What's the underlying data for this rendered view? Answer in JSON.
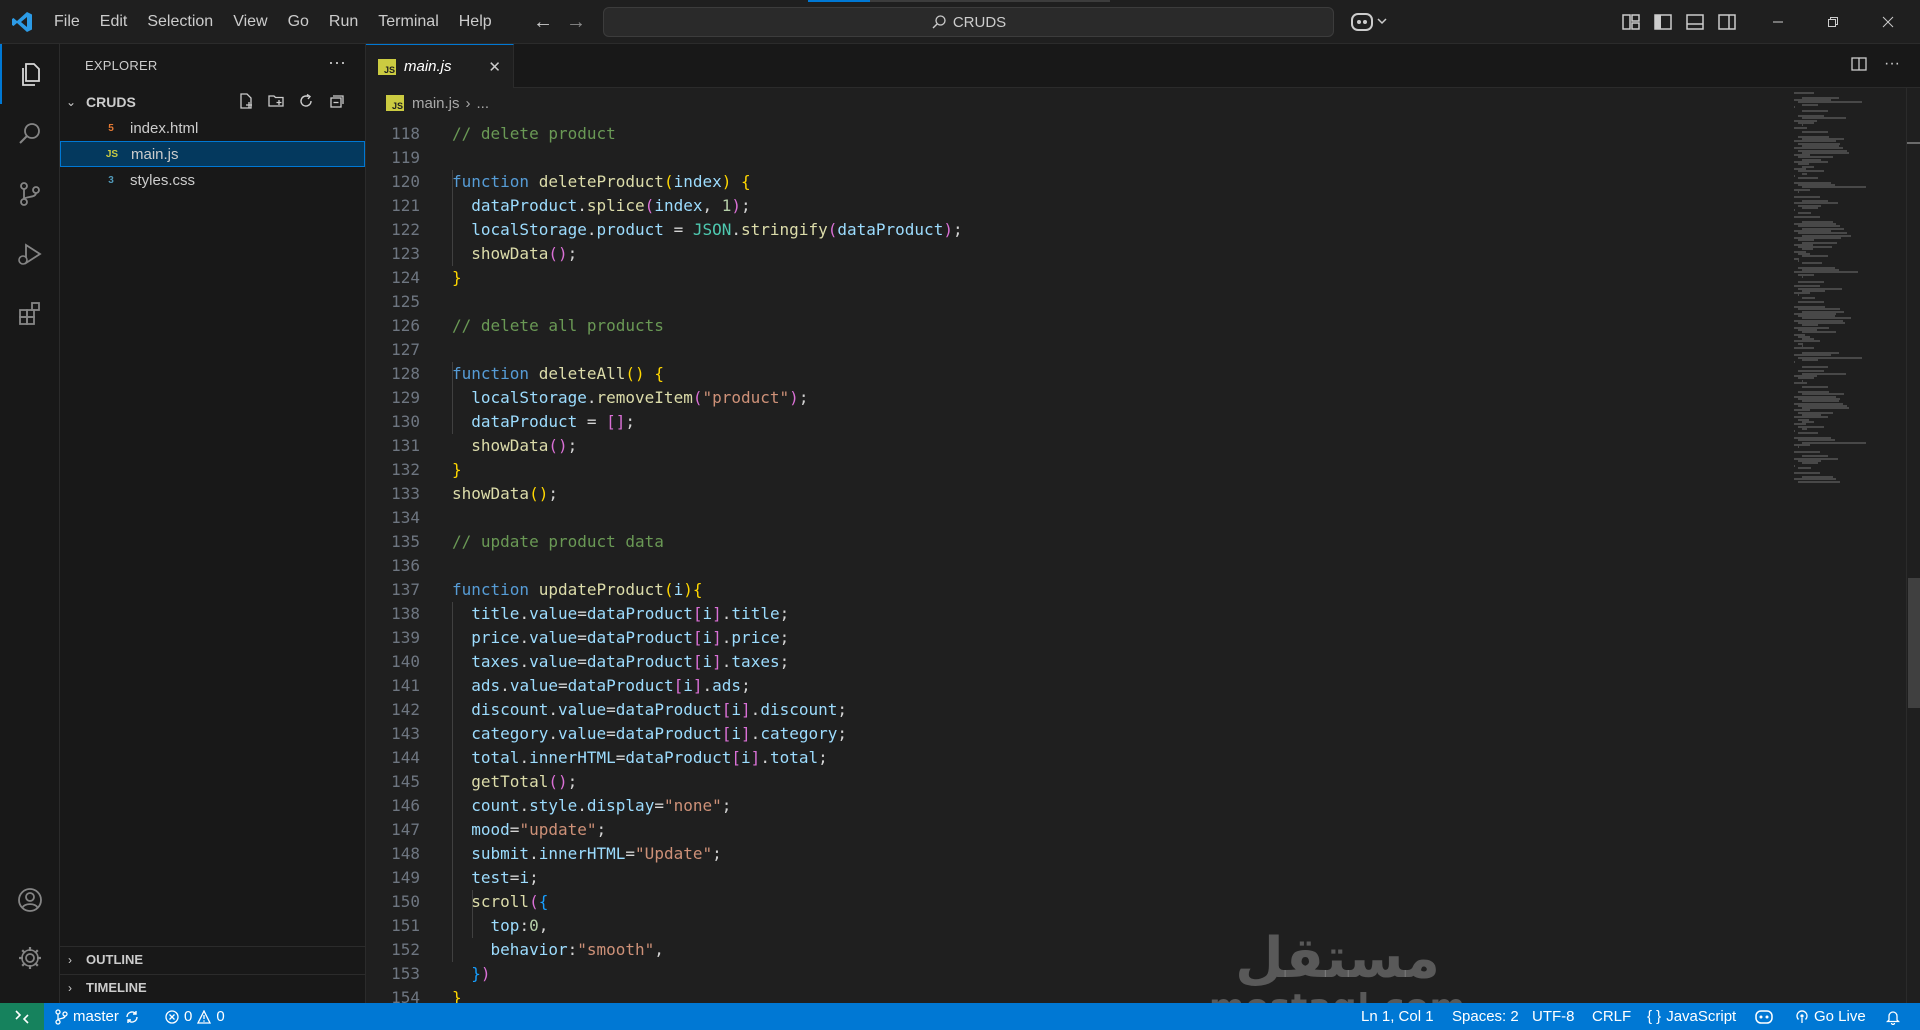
{
  "menu": [
    "File",
    "Edit",
    "Selection",
    "View",
    "Go",
    "Run",
    "Terminal",
    "Help"
  ],
  "search": {
    "text": "CRUDS",
    "icon": "search-icon"
  },
  "explorer": {
    "title": "EXPLORER",
    "folder": "CRUDS",
    "files": [
      {
        "name": "index.html",
        "icon": "html-file-icon",
        "icon_glyph": "5",
        "icon_color": "#e37933"
      },
      {
        "name": "main.js",
        "icon": "js-file-icon",
        "icon_glyph": "JS",
        "icon_color": "#cbcb41"
      },
      {
        "name": "styles.css",
        "icon": "css-file-icon",
        "icon_glyph": "3",
        "icon_color": "#519aba"
      }
    ],
    "outline_label": "OUTLINE",
    "timeline_label": "TIMELINE"
  },
  "editor": {
    "tab_label": "main.js",
    "tab_close": "✕",
    "js_badge": "JS",
    "breadcrumb_file": "main.js",
    "breadcrumb_sep": "›",
    "breadcrumb_more": "...",
    "lines": [
      {
        "n": "118",
        "tokens": [
          [
            "c",
            "// delete product"
          ]
        ]
      },
      {
        "n": "119",
        "tokens": []
      },
      {
        "n": "120",
        "tokens": [
          [
            "k",
            "function "
          ],
          [
            "f",
            "deleteProduct"
          ],
          [
            "p1",
            "("
          ],
          [
            "v",
            "index"
          ],
          [
            "p1",
            ")"
          ],
          [
            "o",
            " "
          ],
          [
            "p1",
            "{"
          ]
        ]
      },
      {
        "n": "121",
        "tokens": [
          [
            "o",
            "  "
          ],
          [
            "v",
            "dataProduct"
          ],
          [
            "o",
            "."
          ],
          [
            "f",
            "splice"
          ],
          [
            "p2",
            "("
          ],
          [
            "v",
            "index"
          ],
          [
            "o",
            ", "
          ],
          [
            "n",
            "1"
          ],
          [
            "p2",
            ")"
          ],
          [
            "o",
            ";"
          ]
        ]
      },
      {
        "n": "122",
        "tokens": [
          [
            "o",
            "  "
          ],
          [
            "v",
            "localStorage"
          ],
          [
            "o",
            "."
          ],
          [
            "v",
            "product"
          ],
          [
            "o",
            " = "
          ],
          [
            "cls",
            "JSON"
          ],
          [
            "o",
            "."
          ],
          [
            "f",
            "stringify"
          ],
          [
            "p2",
            "("
          ],
          [
            "v",
            "dataProduct"
          ],
          [
            "p2",
            ")"
          ],
          [
            "o",
            ";"
          ]
        ]
      },
      {
        "n": "123",
        "tokens": [
          [
            "o",
            "  "
          ],
          [
            "f",
            "showData"
          ],
          [
            "p2",
            "()"
          ],
          [
            "o",
            ";"
          ]
        ]
      },
      {
        "n": "124",
        "tokens": [
          [
            "p1",
            "}"
          ]
        ]
      },
      {
        "n": "125",
        "tokens": []
      },
      {
        "n": "126",
        "tokens": [
          [
            "c",
            "// delete all products"
          ]
        ]
      },
      {
        "n": "127",
        "tokens": []
      },
      {
        "n": "128",
        "tokens": [
          [
            "k",
            "function "
          ],
          [
            "f",
            "deleteAll"
          ],
          [
            "p1",
            "()"
          ],
          [
            "o",
            " "
          ],
          [
            "p1",
            "{"
          ]
        ]
      },
      {
        "n": "129",
        "tokens": [
          [
            "o",
            "  "
          ],
          [
            "v",
            "localStorage"
          ],
          [
            "o",
            "."
          ],
          [
            "f",
            "removeItem"
          ],
          [
            "p2",
            "("
          ],
          [
            "s",
            "\"product\""
          ],
          [
            "p2",
            ")"
          ],
          [
            "o",
            ";"
          ]
        ]
      },
      {
        "n": "130",
        "tokens": [
          [
            "o",
            "  "
          ],
          [
            "v",
            "dataProduct"
          ],
          [
            "o",
            " = "
          ],
          [
            "p2",
            "[]"
          ],
          [
            "o",
            ";"
          ]
        ]
      },
      {
        "n": "131",
        "tokens": [
          [
            "o",
            "  "
          ],
          [
            "f",
            "showData"
          ],
          [
            "p2",
            "()"
          ],
          [
            "o",
            ";"
          ]
        ]
      },
      {
        "n": "132",
        "tokens": [
          [
            "p1",
            "}"
          ]
        ]
      },
      {
        "n": "133",
        "tokens": [
          [
            "f",
            "showData"
          ],
          [
            "p1",
            "()"
          ],
          [
            "o",
            ";"
          ]
        ]
      },
      {
        "n": "134",
        "tokens": []
      },
      {
        "n": "135",
        "tokens": [
          [
            "c",
            "// update product data"
          ]
        ]
      },
      {
        "n": "136",
        "tokens": []
      },
      {
        "n": "137",
        "tokens": [
          [
            "k",
            "function "
          ],
          [
            "f",
            "updateProduct"
          ],
          [
            "p1",
            "("
          ],
          [
            "v",
            "i"
          ],
          [
            "p1",
            ")"
          ],
          [
            "p1",
            "{"
          ]
        ]
      },
      {
        "n": "138",
        "tokens": [
          [
            "o",
            "  "
          ],
          [
            "v",
            "title"
          ],
          [
            "o",
            "."
          ],
          [
            "v",
            "value"
          ],
          [
            "o",
            "="
          ],
          [
            "v",
            "dataProduct"
          ],
          [
            "p2",
            "["
          ],
          [
            "v",
            "i"
          ],
          [
            "p2",
            "]"
          ],
          [
            "o",
            "."
          ],
          [
            "v",
            "title"
          ],
          [
            "o",
            ";"
          ]
        ]
      },
      {
        "n": "139",
        "tokens": [
          [
            "o",
            "  "
          ],
          [
            "v",
            "price"
          ],
          [
            "o",
            "."
          ],
          [
            "v",
            "value"
          ],
          [
            "o",
            "="
          ],
          [
            "v",
            "dataProduct"
          ],
          [
            "p2",
            "["
          ],
          [
            "v",
            "i"
          ],
          [
            "p2",
            "]"
          ],
          [
            "o",
            "."
          ],
          [
            "v",
            "price"
          ],
          [
            "o",
            ";"
          ]
        ]
      },
      {
        "n": "140",
        "tokens": [
          [
            "o",
            "  "
          ],
          [
            "v",
            "taxes"
          ],
          [
            "o",
            "."
          ],
          [
            "v",
            "value"
          ],
          [
            "o",
            "="
          ],
          [
            "v",
            "dataProduct"
          ],
          [
            "p2",
            "["
          ],
          [
            "v",
            "i"
          ],
          [
            "p2",
            "]"
          ],
          [
            "o",
            "."
          ],
          [
            "v",
            "taxes"
          ],
          [
            "o",
            ";"
          ]
        ]
      },
      {
        "n": "141",
        "tokens": [
          [
            "o",
            "  "
          ],
          [
            "v",
            "ads"
          ],
          [
            "o",
            "."
          ],
          [
            "v",
            "value"
          ],
          [
            "o",
            "="
          ],
          [
            "v",
            "dataProduct"
          ],
          [
            "p2",
            "["
          ],
          [
            "v",
            "i"
          ],
          [
            "p2",
            "]"
          ],
          [
            "o",
            "."
          ],
          [
            "v",
            "ads"
          ],
          [
            "o",
            ";"
          ]
        ]
      },
      {
        "n": "142",
        "tokens": [
          [
            "o",
            "  "
          ],
          [
            "v",
            "discount"
          ],
          [
            "o",
            "."
          ],
          [
            "v",
            "value"
          ],
          [
            "o",
            "="
          ],
          [
            "v",
            "dataProduct"
          ],
          [
            "p2",
            "["
          ],
          [
            "v",
            "i"
          ],
          [
            "p2",
            "]"
          ],
          [
            "o",
            "."
          ],
          [
            "v",
            "discount"
          ],
          [
            "o",
            ";"
          ]
        ]
      },
      {
        "n": "143",
        "tokens": [
          [
            "o",
            "  "
          ],
          [
            "v",
            "category"
          ],
          [
            "o",
            "."
          ],
          [
            "v",
            "value"
          ],
          [
            "o",
            "="
          ],
          [
            "v",
            "dataProduct"
          ],
          [
            "p2",
            "["
          ],
          [
            "v",
            "i"
          ],
          [
            "p2",
            "]"
          ],
          [
            "o",
            "."
          ],
          [
            "v",
            "category"
          ],
          [
            "o",
            ";"
          ]
        ]
      },
      {
        "n": "144",
        "tokens": [
          [
            "o",
            "  "
          ],
          [
            "v",
            "total"
          ],
          [
            "o",
            "."
          ],
          [
            "v",
            "innerHTML"
          ],
          [
            "o",
            "="
          ],
          [
            "v",
            "dataProduct"
          ],
          [
            "p2",
            "["
          ],
          [
            "v",
            "i"
          ],
          [
            "p2",
            "]"
          ],
          [
            "o",
            "."
          ],
          [
            "v",
            "total"
          ],
          [
            "o",
            ";"
          ]
        ]
      },
      {
        "n": "145",
        "tokens": [
          [
            "o",
            "  "
          ],
          [
            "f",
            "getTotal"
          ],
          [
            "p2",
            "()"
          ],
          [
            "o",
            ";"
          ]
        ]
      },
      {
        "n": "146",
        "tokens": [
          [
            "o",
            "  "
          ],
          [
            "v",
            "count"
          ],
          [
            "o",
            "."
          ],
          [
            "v",
            "style"
          ],
          [
            "o",
            "."
          ],
          [
            "v",
            "display"
          ],
          [
            "o",
            "="
          ],
          [
            "s",
            "\"none\""
          ],
          [
            "o",
            ";"
          ]
        ]
      },
      {
        "n": "147",
        "tokens": [
          [
            "o",
            "  "
          ],
          [
            "v",
            "mood"
          ],
          [
            "o",
            "="
          ],
          [
            "s",
            "\"update\""
          ],
          [
            "o",
            ";"
          ]
        ]
      },
      {
        "n": "148",
        "tokens": [
          [
            "o",
            "  "
          ],
          [
            "v",
            "submit"
          ],
          [
            "o",
            "."
          ],
          [
            "v",
            "innerHTML"
          ],
          [
            "o",
            "="
          ],
          [
            "s",
            "\"Update\""
          ],
          [
            "o",
            ";"
          ]
        ]
      },
      {
        "n": "149",
        "tokens": [
          [
            "o",
            "  "
          ],
          [
            "v",
            "test"
          ],
          [
            "o",
            "="
          ],
          [
            "v",
            "i"
          ],
          [
            "o",
            ";"
          ]
        ]
      },
      {
        "n": "150",
        "tokens": [
          [
            "o",
            "  "
          ],
          [
            "f",
            "scroll"
          ],
          [
            "p2",
            "("
          ],
          [
            "p3",
            "{"
          ]
        ]
      },
      {
        "n": "151",
        "tokens": [
          [
            "o",
            "    "
          ],
          [
            "v",
            "top"
          ],
          [
            "o",
            ":"
          ],
          [
            "n",
            "0"
          ],
          [
            "o",
            ","
          ]
        ]
      },
      {
        "n": "152",
        "tokens": [
          [
            "o",
            "    "
          ],
          [
            "v",
            "behavior"
          ],
          [
            "o",
            ":"
          ],
          [
            "s",
            "\"smooth\""
          ],
          [
            "o",
            ","
          ]
        ]
      },
      {
        "n": "153",
        "tokens": [
          [
            "o",
            "  "
          ],
          [
            "p3",
            "}"
          ],
          [
            "p2",
            ")"
          ]
        ]
      },
      {
        "n": "154",
        "tokens": [
          [
            "p1",
            "}"
          ]
        ]
      }
    ]
  },
  "watermark": {
    "arabic": "مستقل",
    "latin": "mostaql.com"
  },
  "status": {
    "branch": "master",
    "errors": "0",
    "warnings": "0",
    "position": "Ln 1, Col 1",
    "spaces": "Spaces: 2",
    "encoding": "UTF-8",
    "eol": "CRLF",
    "language": "JavaScript",
    "language_prefix": "{ }",
    "golive": "Go Live"
  },
  "colors": {
    "accent": "#0078d4",
    "remote": "#16825d",
    "editor_bg": "#1f1f1f",
    "sidebar_bg": "#181818"
  }
}
